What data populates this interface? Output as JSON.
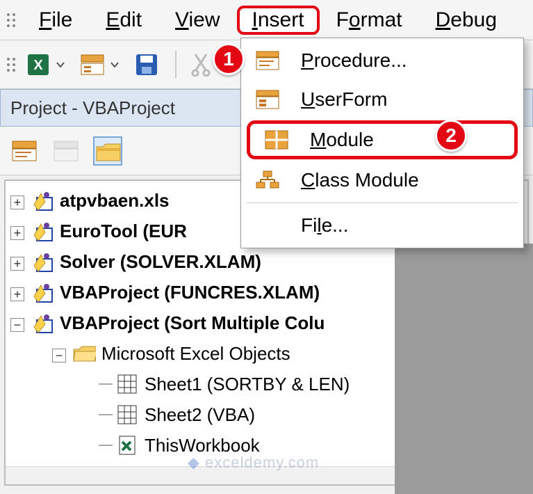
{
  "menubar": {
    "file": "File",
    "edit": "Edit",
    "view": "View",
    "insert": "Insert",
    "format": "Format",
    "debug": "Debug"
  },
  "panel": {
    "title": "Project - VBAProject"
  },
  "tree": {
    "n0": "atpvbaen.xls",
    "n1": "EuroTool (EUR",
    "n2": "Solver (SOLVER.XLAM)",
    "n3": "VBAProject (FUNCRES.XLAM)",
    "n4": "VBAProject (Sort Multiple Colu",
    "folder": "Microsoft Excel Objects",
    "s1": "Sheet1 (SORTBY & LEN)",
    "s2": "Sheet2 (VBA)",
    "tw": "ThisWorkbook"
  },
  "dropdown": {
    "procedure": "Procedure...",
    "userform": "UserForm",
    "module": "Module",
    "classmodule": "Class Module",
    "file": "File..."
  },
  "badges": {
    "b1": "1",
    "b2": "2"
  },
  "watermark": "exceldemy.com"
}
